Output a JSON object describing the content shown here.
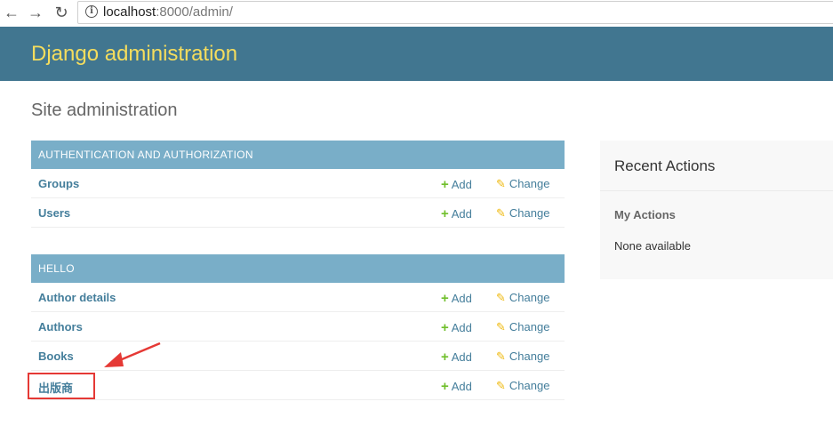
{
  "browser": {
    "url_host": "localhost",
    "url_rest": ":8000/admin/"
  },
  "header": {
    "brand": "Django administration"
  },
  "page_title": "Site administration",
  "modules": [
    {
      "caption": "AUTHENTICATION AND AUTHORIZATION",
      "rows": [
        {
          "name": "Groups"
        },
        {
          "name": "Users"
        }
      ]
    },
    {
      "caption": "HELLO",
      "rows": [
        {
          "name": "Author details"
        },
        {
          "name": "Authors"
        },
        {
          "name": "Books"
        },
        {
          "name": "出版商"
        }
      ]
    }
  ],
  "actions": {
    "add_label": "Add",
    "change_label": "Change"
  },
  "recent_actions": {
    "title": "Recent Actions",
    "my_actions": "My Actions",
    "none": "None available"
  },
  "colors": {
    "header_bg": "#417690",
    "brand": "#f5dd5d",
    "module_head": "#79aec8",
    "link": "#447e9b",
    "add_icon": "#70bf2b",
    "change_icon": "#efb80b",
    "annotation": "#e53935"
  },
  "icons": {
    "back": "arrow-left-icon",
    "forward": "arrow-right-icon",
    "reload": "reload-icon",
    "info": "info-icon",
    "add": "plus-icon",
    "change": "pencil-icon"
  }
}
